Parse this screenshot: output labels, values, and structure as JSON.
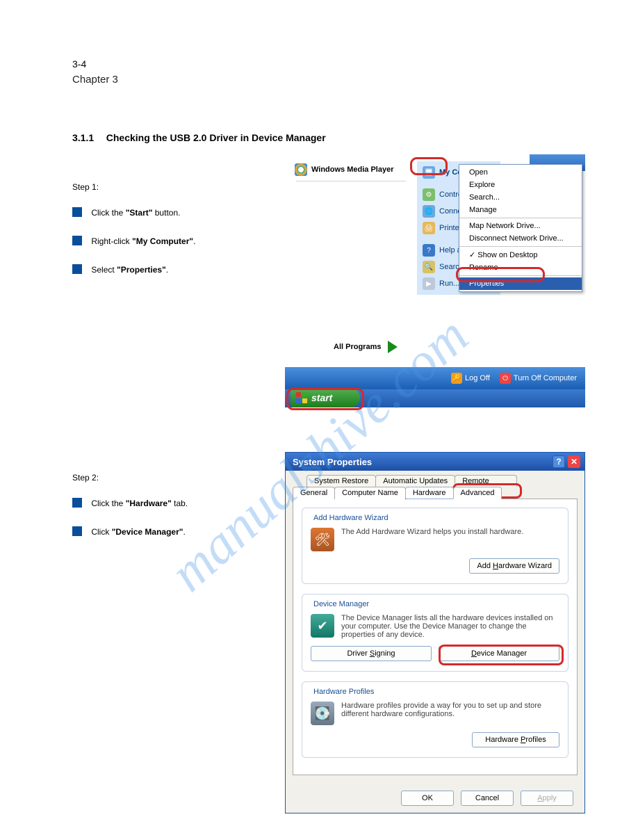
{
  "watermark": "manualshive.com",
  "header": {
    "page_no": "3-4",
    "page_sub": "Chapter 3"
  },
  "section1": {
    "title": "3.1.1 Checking the USB 2.0 Driver in Device Manager",
    "title_prefix": "3.1.1",
    "title_rest": "Checking the USB 2.0 Driver in Device Manager",
    "step_label": "Step 1:",
    "bullets": [
      "Click the \"Start\" button.",
      "Right-click \"My Computer\".",
      "Select \"Properties\"."
    ],
    "b_click_the": "Click the ",
    "b_start": "\"Start\"",
    "b_button": " button.",
    "b_right_click": "Right-click ",
    "b_mycomp": "\"My Computer\"",
    "b_period": ".",
    "b_select": "Select ",
    "b_properties": "\"Properties\""
  },
  "start_menu": {
    "wmp_label": "Windows Media Player",
    "all_programs": "All Programs",
    "right_items": [
      "My Com",
      "Control P",
      "Connect",
      "Printers a",
      "Help and",
      "Search",
      "Run..."
    ],
    "logoff": "Log Off",
    "turnoff": "Turn Off Computer",
    "start_label": "start"
  },
  "context_menu": {
    "items_top": [
      "Open",
      "Explore",
      "Search...",
      "Manage"
    ],
    "items_mid": [
      "Map Network Drive...",
      "Disconnect Network Drive..."
    ],
    "items_mid2": [
      "Show on Desktop",
      "Rename"
    ],
    "selected": "Properties"
  },
  "section2": {
    "step_label": "Step 2:",
    "b_click_the": "Click the ",
    "b_hardware": "\"Hardware\"",
    "b_tab": " tab.",
    "b_click": "Click ",
    "b_devmgr": "\"Device Manager\"",
    "b_period": "."
  },
  "sysprop": {
    "title": "System Properties",
    "tabs_back": [
      "System Restore",
      "Automatic Updates",
      "Remote"
    ],
    "tabs_front": [
      "General",
      "Computer Name",
      "Hardware",
      "Advanced"
    ],
    "group_add_hw": {
      "title": "Add Hardware Wizard",
      "text": "The Add Hardware Wizard helps you install hardware.",
      "button": "Add Hardware Wizard"
    },
    "group_devmgr": {
      "title": "Device Manager",
      "text": "The Device Manager lists all the hardware devices installed on your computer. Use the Device Manager to change the properties of any device.",
      "button_left": "Driver Signing",
      "button_right": "Device Manager"
    },
    "group_hwprof": {
      "title": "Hardware Profiles",
      "text": "Hardware profiles provide a way for you to set up and store different hardware configurations.",
      "button": "Hardware Profiles"
    },
    "footer": {
      "ok": "OK",
      "cancel": "Cancel",
      "apply": "Apply"
    }
  }
}
